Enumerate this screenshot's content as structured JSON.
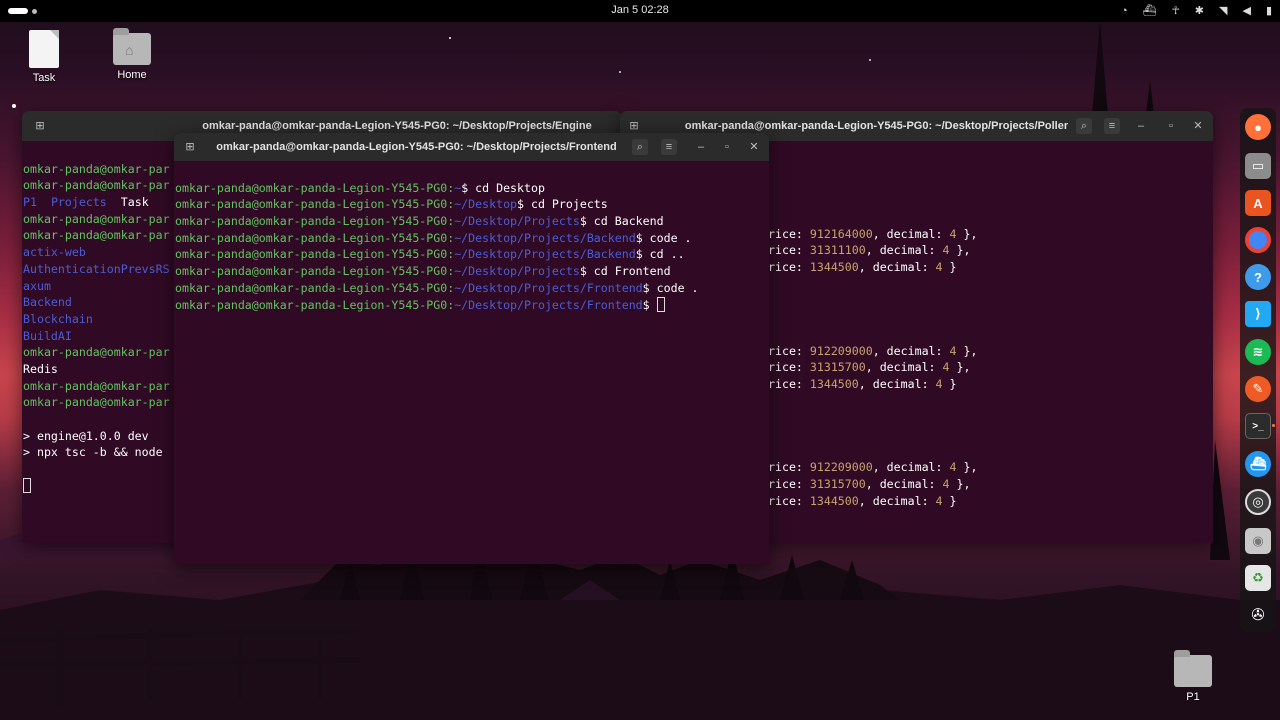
{
  "topbar": {
    "clock": "Jan 5  02:28"
  },
  "desktop": {
    "icons": [
      {
        "label": "Task"
      },
      {
        "label": "Home"
      },
      {
        "label": "P1"
      }
    ]
  },
  "engine": {
    "title": "omkar-panda@omkar-panda-Legion-Y545-PG0: ~/Desktop/Projects/Engine",
    "prompt": "omkar-panda@omkar-par",
    "ls1": [
      "P1",
      "Projects",
      "Task"
    ],
    "dirs": [
      "actix-web",
      "AuthenticationPrevsRS",
      "axum",
      "Backend",
      "Blockchain",
      "BuildAI"
    ],
    "redis": "Redis",
    "npm1": "> engine@1.0.0 dev",
    "npm2": "> npx tsc -b && node"
  },
  "frontend": {
    "title": "omkar-panda@omkar-panda-Legion-Y545-PG0: ~/Desktop/Projects/Frontend",
    "user": "omkar-panda@omkar-panda-Legion-Y545-PG0:",
    "lines": [
      {
        "path": "~",
        "cmd": "$ cd Desktop"
      },
      {
        "path": "~/Desktop",
        "cmd": "$ cd Projects"
      },
      {
        "path": "~/Desktop/Projects",
        "cmd": "$ cd Backend"
      },
      {
        "path": "~/Desktop/Projects/Backend",
        "cmd": "$ code ."
      },
      {
        "path": "~/Desktop/Projects/Backend",
        "cmd": "$ cd .."
      },
      {
        "path": "~/Desktop/Projects",
        "cmd": "$ cd Frontend"
      },
      {
        "path": "~/Desktop/Projects/Frontend",
        "cmd": "$ code ."
      },
      {
        "path": "~/Desktop/Projects/Frontend",
        "cmd": "$ "
      }
    ]
  },
  "poller": {
    "title": "omkar-panda@omkar-panda-Legion-Y545-PG0: ~/Desktop/Projects/Poller",
    "groups": [
      [
        {
          "pre": "rice: ",
          "price": "912164000",
          "mid": ", decimal: ",
          "dec": "4",
          "end": " },"
        },
        {
          "pre": "rice: ",
          "price": "31311100",
          "mid": ", decimal: ",
          "dec": "4",
          "end": " },"
        },
        {
          "pre": "rice: ",
          "price": "1344500",
          "mid": ", decimal: ",
          "dec": "4",
          "end": " }"
        }
      ],
      [
        {
          "pre": "rice: ",
          "price": "912209000",
          "mid": ", decimal: ",
          "dec": "4",
          "end": " },"
        },
        {
          "pre": "rice: ",
          "price": "31315700",
          "mid": ", decimal: ",
          "dec": "4",
          "end": " },"
        },
        {
          "pre": "rice: ",
          "price": "1344500",
          "mid": ", decimal: ",
          "dec": "4",
          "end": " }"
        }
      ],
      [
        {
          "pre": "rice: ",
          "price": "912209000",
          "mid": ", decimal: ",
          "dec": "4",
          "end": " },"
        },
        {
          "pre": "rice: ",
          "price": "31315700",
          "mid": ", decimal: ",
          "dec": "4",
          "end": " },"
        },
        {
          "pre": "rice: ",
          "price": "1344500",
          "mid": ", decimal: ",
          "dec": "4",
          "end": " }"
        }
      ]
    ]
  },
  "dock": {
    "apps": [
      "firefox-icon",
      "files-icon",
      "app-center-icon",
      "chrome-icon",
      "help-icon",
      "vscode-icon",
      "spotify-icon",
      "postman-icon",
      "terminal-icon",
      "docker-icon",
      "obs-icon",
      "disk-icon",
      "trash-icon",
      "show-apps-icon"
    ],
    "colors": {
      "firefox": "#ff7139",
      "chrome": "#4285f4",
      "help": "#3d9be9",
      "vscode": "#23a9f2",
      "spotify": "#1db954",
      "postman": "#ef5b25",
      "docker": "#2496ed"
    }
  }
}
